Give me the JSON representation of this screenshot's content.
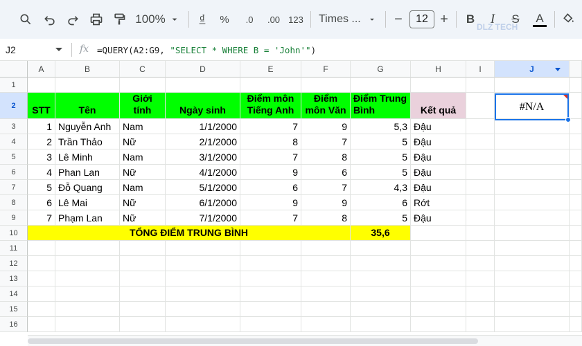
{
  "toolbar": {
    "zoom": "100%",
    "currency": "₫",
    "percent": "%",
    "dec_decrease": ".0",
    "dec_increase": ".00",
    "format_number": "123",
    "font": "Times ...",
    "font_size": "12",
    "minus": "−",
    "plus": "+",
    "bold": "B",
    "italic": "I",
    "strike": "S"
  },
  "watermark": "DLZ TECH",
  "formula_bar": {
    "cell_ref": "J2",
    "fx": "fx",
    "formula_prefix": "=QUERY(A2:G9, ",
    "formula_string": "\"SELECT * WHERE B = 'John'\"",
    "formula_suffix": ")"
  },
  "columns": [
    "A",
    "B",
    "C",
    "D",
    "E",
    "F",
    "G",
    "H",
    "I",
    "J"
  ],
  "rows": [
    "1",
    "2",
    "3",
    "4",
    "5",
    "6",
    "7",
    "8",
    "9",
    "10",
    "11",
    "12",
    "13",
    "14",
    "15",
    "16"
  ],
  "table": {
    "headers": {
      "stt": "STT",
      "ten": "Tên",
      "gioi_tinh": "Giới tính",
      "ngay_sinh": "Ngày sinh",
      "diem_anh": "Điểm môn Tiếng Anh",
      "diem_van": "Điểm môn Văn",
      "diem_tb": "Điểm Trung Bình",
      "ket_qua": "Kết quả"
    },
    "records": [
      [
        "1",
        "Nguyễn Anh",
        "Nam",
        "1/1/2000",
        "7",
        "9",
        "5,3",
        "Đậu"
      ],
      [
        "2",
        "Trần Thảo",
        "Nữ",
        "2/1/2000",
        "8",
        "7",
        "5",
        "Đậu"
      ],
      [
        "3",
        "Lê Minh",
        "Nam",
        "3/1/2000",
        "7",
        "8",
        "5",
        "Đậu"
      ],
      [
        "4",
        "Phan Lan",
        "Nữ",
        "4/1/2000",
        "9",
        "6",
        "5",
        "Đậu"
      ],
      [
        "5",
        "Đỗ Quang",
        "Nam",
        "5/1/2000",
        "6",
        "7",
        "4,3",
        "Đậu"
      ],
      [
        "6",
        "Lê Mai",
        "Nữ",
        "6/1/2000",
        "9",
        "9",
        "6",
        "Rớt"
      ],
      [
        "7",
        "Phạm Lan",
        "Nữ",
        "7/1/2000",
        "7",
        "8",
        "5",
        "Đậu"
      ]
    ],
    "total_label": "TỔNG ĐIỂM TRUNG BÌNH",
    "total_value": "35,6"
  },
  "selected_cell_value": "#N/A",
  "colors": {
    "header_fill": "#00ff00",
    "result_header_fill": "#ead1dc",
    "total_fill": "#ffff00",
    "selection": "#1a73e8"
  }
}
